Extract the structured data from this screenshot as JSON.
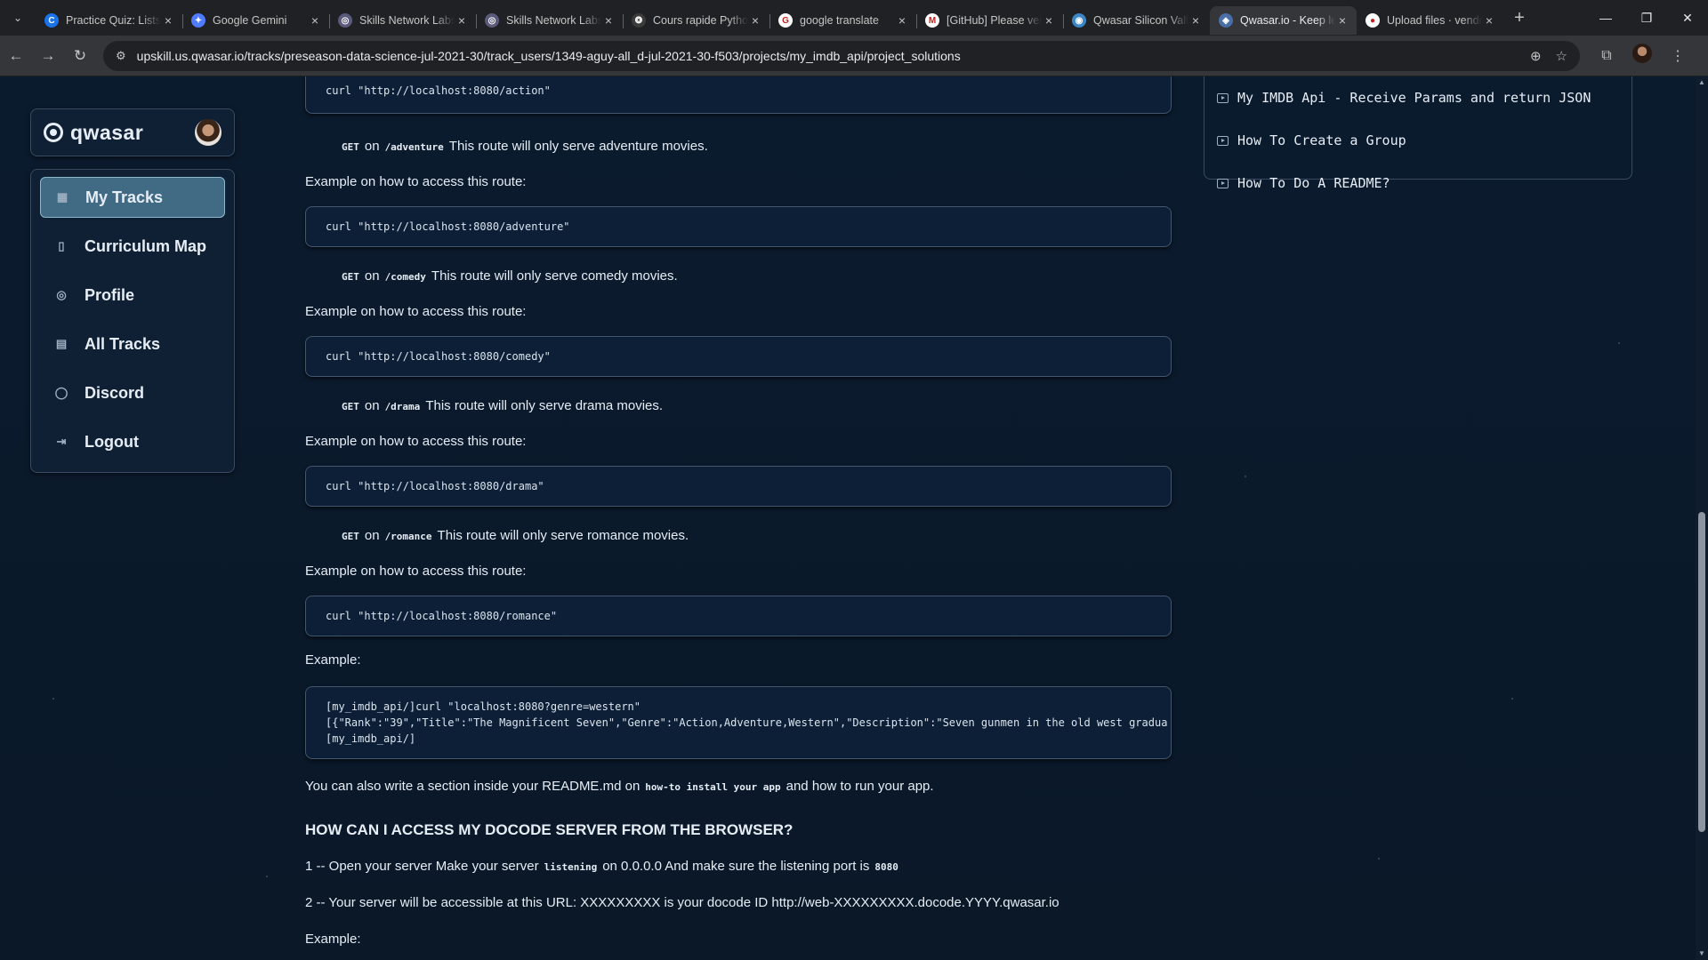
{
  "browser": {
    "tabs": [
      {
        "title": "Practice Quiz: Lists",
        "fav_color": "#1a73e8",
        "fav_glyph": "C"
      },
      {
        "title": "Google Gemini",
        "fav_color": "#4f7cff",
        "fav_glyph": "✦"
      },
      {
        "title": "Skills Network Labs",
        "fav_color": "#5a5a7a",
        "fav_glyph": "◎"
      },
      {
        "title": "Skills Network Labs",
        "fav_color": "#5a5a7a",
        "fav_glyph": "◎"
      },
      {
        "title": "Cours rapide Python",
        "fav_color": "#3b3b3b",
        "fav_glyph": "❂"
      },
      {
        "title": "google translate",
        "fav_color": "#ffffff",
        "fav_glyph": "G"
      },
      {
        "title": "[GitHub] Please verify",
        "fav_color": "#ffffff",
        "fav_glyph": "M"
      },
      {
        "title": "Qwasar Silicon Valley",
        "fav_color": "#3d86c6",
        "fav_glyph": "◉"
      },
      {
        "title": "Qwasar.io - Keep learning",
        "fav_color": "#4a6ea8",
        "fav_glyph": "◈",
        "active": true
      },
      {
        "title": "Upload files · vendor",
        "fav_color": "#ffffff",
        "fav_glyph": "●"
      }
    ],
    "url": "upskill.us.qwasar.io/tracks/preseason-data-science-jul-2021-30/track_users/1349-aguy-all_d-jul-2021-30-f503/projects/my_imdb_api/project_solutions"
  },
  "sidebar": {
    "brand": "qwasar",
    "items": [
      {
        "label": "My Tracks",
        "icon": "grid-icon",
        "glyph": "▦"
      },
      {
        "label": "Curriculum Map",
        "icon": "map-icon",
        "glyph": "▯"
      },
      {
        "label": "Profile",
        "icon": "user-circle-icon",
        "glyph": "◎"
      },
      {
        "label": "All Tracks",
        "icon": "book-icon",
        "glyph": "▤"
      },
      {
        "label": "Discord",
        "icon": "chat-bubble-icon",
        "glyph": "◯"
      },
      {
        "label": "Logout",
        "icon": "logout-icon",
        "glyph": "⇥"
      }
    ]
  },
  "content": {
    "code_action": "curl \"http://localhost:8080/action\"",
    "routes": [
      {
        "method": "GET",
        "on": "on",
        "path": "/adventure",
        "desc": "This route will only serve adventure movies.",
        "example_label": "Example on how to access this route:",
        "code": "curl \"http://localhost:8080/adventure\""
      },
      {
        "method": "GET",
        "on": "on",
        "path": "/comedy",
        "desc": "This route will only serve comedy movies.",
        "example_label": "Example on how to access this route:",
        "code": "curl \"http://localhost:8080/comedy\""
      },
      {
        "method": "GET",
        "on": "on",
        "path": "/drama",
        "desc": "This route will only serve drama movies.",
        "example_label": "Example on how to access this route:",
        "code": "curl \"http://localhost:8080/drama\""
      },
      {
        "method": "GET",
        "on": "on",
        "path": "/romance",
        "desc": "This route will only serve romance movies.",
        "example_label": "Example on how to access this route:",
        "code": "curl \"http://localhost:8080/romance\""
      }
    ],
    "example_label": "Example:",
    "example_lines": [
      "[my_imdb_api/]curl \"localhost:8080?genre=western\"",
      "[{\"Rank\":\"39\",\"Title\":\"The Magnificent Seven\",\"Genre\":\"Action,Adventure,Western\",\"Description\":\"Seven gunmen in the old west gradua",
      "[my_imdb_api/]"
    ],
    "readme_pre": "You can also write a section inside your README.md on",
    "readme_code": "how-to install your app",
    "readme_post": "and how to run your app.",
    "heading": "HOW CAN I ACCESS MY DOCODE SERVER FROM THE BROWSER?",
    "step1_pre": "1 -- Open your server Make your server",
    "step1_code1": "listening",
    "step1_mid": "on 0.0.0.0 And make sure the listening port is",
    "step1_code2": "8080",
    "step2": "2 -- Your server will be accessible at this URL: XXXXXXXXX is your docode ID http://web-XXXXXXXXX.docode.YYYY.qwasar.io",
    "example_label2": "Example:"
  },
  "related": [
    "My IMDB Api - Receive Params and return JSON",
    "How To Create a Group",
    "How To Do A README?"
  ]
}
